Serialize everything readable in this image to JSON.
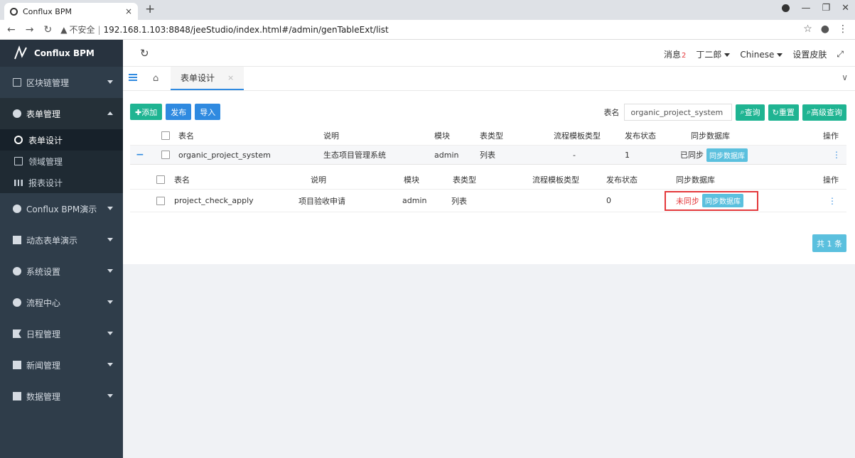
{
  "browser": {
    "tab_title": "Conflux BPM",
    "tab_close": "×",
    "new_tab": "+",
    "insecure": "不安全",
    "url": "192.168.1.103:8848/jeeStudio/index.html#/admin/genTableExt/list"
  },
  "sidebar": {
    "brand": "Conflux BPM",
    "items": [
      {
        "label": "区块链管理"
      },
      {
        "label": "表单管理"
      },
      {
        "label": "Conflux BPM演示"
      },
      {
        "label": "动态表单演示"
      },
      {
        "label": "系统设置"
      },
      {
        "label": "流程中心"
      },
      {
        "label": "日程管理"
      },
      {
        "label": "新闻管理"
      },
      {
        "label": "数据管理"
      }
    ],
    "subitems": [
      {
        "label": "表单设计"
      },
      {
        "label": "领域管理"
      },
      {
        "label": "报表设计"
      }
    ]
  },
  "header": {
    "messages": "消息",
    "messages_count": "2",
    "user": "丁二郎",
    "language": "Chinese",
    "skin": "设置皮肤"
  },
  "pagetabs": {
    "active": "表单设计"
  },
  "toolbar": {
    "add": "✚添加",
    "publish": "发布",
    "import": "导入"
  },
  "search": {
    "label": "表名",
    "value": "organic_project_system",
    "query": "查询",
    "reset": "重置",
    "advanced": "高级查询"
  },
  "table": {
    "headers": [
      "表名",
      "说明",
      "模块",
      "表类型",
      "流程模板类型",
      "发布状态",
      "同步数据库",
      "操作"
    ],
    "main_row": {
      "name": "organic_project_system",
      "desc": "生态项目管理系统",
      "module": "admin",
      "type": "列表",
      "flow": "-",
      "publish": "1",
      "sync_status": "已同步",
      "sync_btn": "同步数据库"
    },
    "sub_headers": [
      "表名",
      "说明",
      "模块",
      "表类型",
      "流程模板类型",
      "发布状态",
      "同步数据库",
      "操作"
    ],
    "sub_row": {
      "name": "project_check_apply",
      "desc": "项目验收申请",
      "module": "admin",
      "type": "列表",
      "publish": "0",
      "sync_status": "未同步",
      "sync_btn": "同步数据库"
    }
  },
  "pager": {
    "total": "共 1 条"
  }
}
